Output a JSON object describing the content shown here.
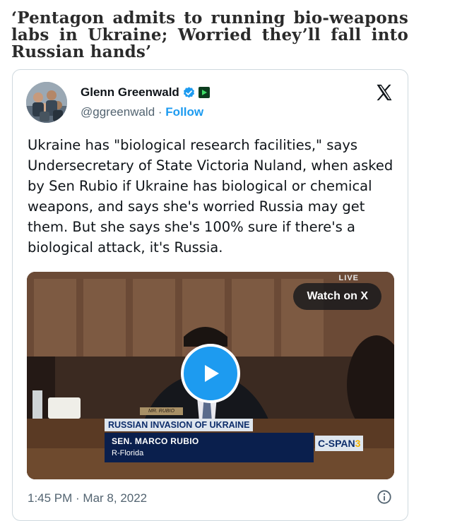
{
  "article": {
    "headline": "‘Pentagon admits to running bio-weapons labs in Ukraine; Worried they’ll fall into Russian hands’"
  },
  "tweet": {
    "author_name": "Glenn Greenwald",
    "handle": "@ggreenwald",
    "separator": "·",
    "follow_label": "Follow",
    "text": "Ukraine has \"biological research facilities,\" says Undersecretary of State Victoria Nuland, when asked by Sen Rubio if Ukraine has biological or chemical weapons, and says she's worried Russia may get them. But she says she's 100% sure if there's a biological attack, it's Russia.",
    "timestamp": "1:45 PM · Mar 8, 2022",
    "icons": [
      "verified-badge-icon",
      "video-badge-icon",
      "x-logo-icon",
      "play-icon",
      "info-icon"
    ],
    "accent_color": "#1d9bf0"
  },
  "video": {
    "watch_label": "Watch on X",
    "live_label": "LIVE",
    "nameplate": "MR. RUBIO",
    "banner_top": "RUSSIAN INVASION OF UKRAINE",
    "banner_name": "SEN. MARCO RUBIO",
    "banner_sub": "R-Florida",
    "network": "C-SPAN",
    "network_num": "3"
  }
}
